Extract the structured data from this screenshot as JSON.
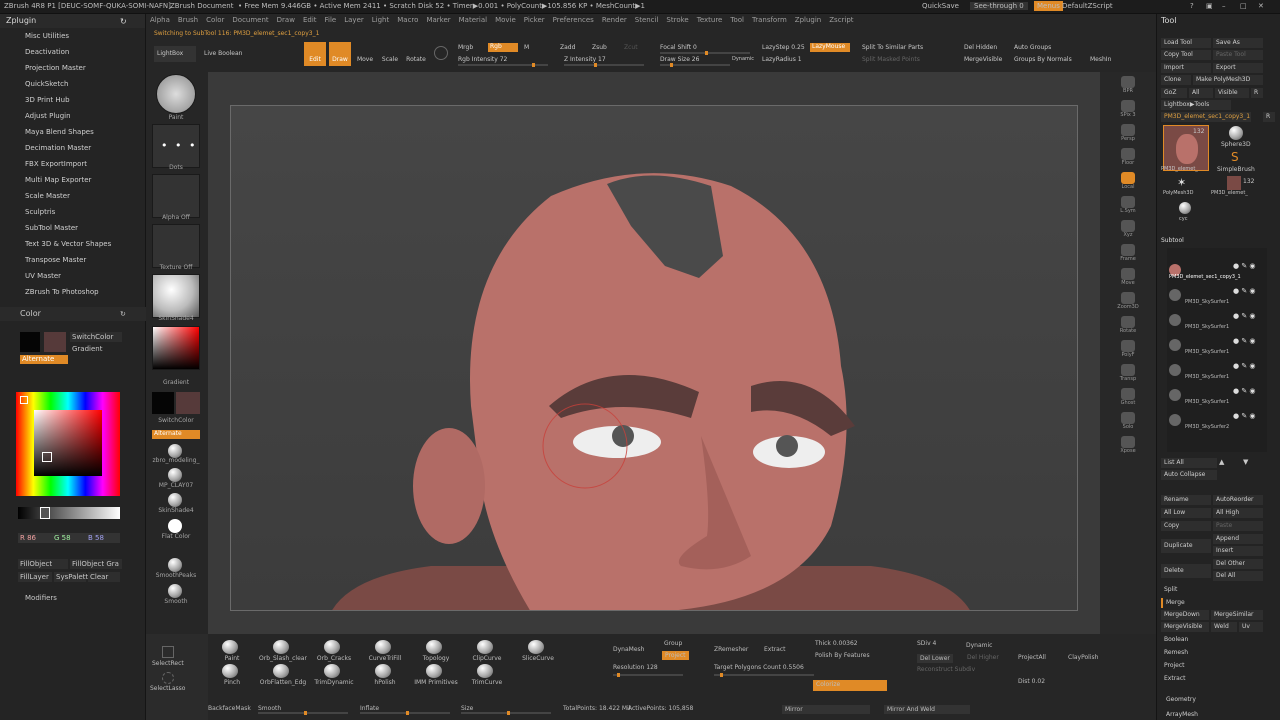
{
  "titlebar": {
    "app": "ZBrush 4R8 P1 [DEUC-SOMF-QUKA-SOMI-NAFN]",
    "doc": "ZBrush Document",
    "stats": "• Free Mem 9.446GB • Active Mem 2411 • Scratch Disk 52 • Timer▶0.001 • PolyCount▶105.856 KP • MeshCount▶1",
    "quicksave": "QuickSave",
    "seethrough": "See-through  0",
    "menus": "Menus",
    "defaultscript": "DefaultZScript"
  },
  "menubar": [
    "Alpha",
    "Brush",
    "Color",
    "Document",
    "Draw",
    "Edit",
    "File",
    "Layer",
    "Light",
    "Macro",
    "Marker",
    "Material",
    "Movie",
    "Picker",
    "Preferences",
    "Render",
    "Stencil",
    "Stroke",
    "Texture",
    "Tool",
    "Transform",
    "Zplugin",
    "Zscript"
  ],
  "zplugin": {
    "title": "Zplugin",
    "items": [
      "Misc Utilities",
      "Deactivation",
      "Projection Master",
      "QuickSketch",
      "3D Print Hub",
      "Adjust Plugin",
      "Maya Blend Shapes",
      "Decimation Master",
      "FBX ExportImport",
      "Multi Map Exporter",
      "Scale Master",
      "Sculptris",
      "SubTool Master",
      "Text 3D & Vector Shapes",
      "Transpose Master",
      "UV Master",
      "ZBrush To Photoshop"
    ]
  },
  "colorpanel": {
    "title": "Color",
    "switchcolor": "SwitchColor",
    "gradient": "Gradient",
    "alternate": "Alternate",
    "r": "R 86",
    "g": "G 58",
    "b": "B 58",
    "fillobject": "FillObject",
    "fillobject_gra": "FillObject Gra",
    "filllayer": "FillLayer",
    "syspalette": "SysPalette",
    "clear": "Clear",
    "modifiers": "Modifiers"
  },
  "shelf": {
    "switching": "Switching to SubTool 116:  PM3D_elemet_sec1_copy3_1",
    "lightbox": "LightBox",
    "liveboolean": "Live Boolean",
    "edit": "Edit",
    "draw": "Draw",
    "move": "Move",
    "scale": "Scale",
    "rotate": "Rotate",
    "mrgb": "Mrgb",
    "rgb": "Rgb",
    "m": "M",
    "rgbintensity": "Rgb Intensity 72",
    "zadd": "Zadd",
    "zsub": "Zsub",
    "zcut": "Zcut",
    "zintensity": "Z Intensity 17",
    "focalshift": "Focal Shift 0",
    "drawsize": "Draw Size 26",
    "dynamic": "Dynamic",
    "lazystep": "LazyStep 0.25",
    "lazymouse": "LazyMouse",
    "lazyradius": "LazyRadius 1",
    "splitsimilar": "Split To Similar Parts",
    "splitmasked": "Split Masked Points",
    "delhidden": "Del Hidden",
    "mergevisible": "MergeVisible",
    "autogroups": "Auto Groups",
    "groupsbynormals": "Groups By Normals",
    "mesh": "MeshIn"
  },
  "brushcol": {
    "paint": "Paint",
    "dots": "Dots",
    "alphaoff": "Alpha Off",
    "textureoff": "Texture Off",
    "skinshade4": "SkinShade4",
    "gradient": "Gradient",
    "switchcolor": "SwitchColor",
    "alternate": "Alternate",
    "mat1": "zbro_modeling_",
    "mat2": "MP_CLAY07",
    "mat3": "SkinShade4",
    "mat4": "Flat Color",
    "smoothpeaks": "SmoothPeaks",
    "smooth": "Smooth"
  },
  "rightstrip": [
    "BPR",
    "SPix 3",
    "Persp",
    "Floor",
    "Local",
    "L.Sym",
    "Xyz",
    "Frame",
    "Move",
    "Zoom3D",
    "Rotate",
    "PolyF",
    "Transp",
    "Ghost",
    "Solo",
    "Xpose"
  ],
  "toolpanel": {
    "title": "Tool",
    "loadtool": "Load Tool",
    "saveas": "Save As",
    "copytool": "Copy Tool",
    "pastetool": "Paste Tool",
    "import": "Import",
    "export": "Export",
    "clone": "Clone",
    "makepolymesh": "Make PolyMesh3D",
    "goz": "GoZ",
    "all": "All",
    "visible": "Visible",
    "r": "R",
    "lightbox": "Lightbox▶Tools",
    "current": "PM3D_elemet_sec1_copy3_1",
    "r2": "R",
    "count132": "132",
    "sphere3d": "Sphere3D",
    "simplebrush": "SimpleBrush",
    "current_thumb": "PM3D_elemet_",
    "polymesh3d": "PolyMesh3D",
    "pm3d2": "PM3D_elemet_",
    "count132b": "132",
    "cyc": "cyc",
    "subtool": "Subtool",
    "subtools": [
      "PM3D_elemet_sec1_copy3_1",
      "PM3D_SkySurfer1",
      "PM3D_SkySurfer1",
      "PM3D_SkySurfer1",
      "PM3D_SkySurfer1",
      "PM3D_SkySurfer1",
      "PM3D_SkySurfer2"
    ],
    "listall": "List All",
    "autocollapse": "Auto Collapse",
    "rename": "Rename",
    "autoreorder": "AutoReorder",
    "alllow": "All Low",
    "allhigh": "All High",
    "copy": "Copy",
    "paste": "Paste",
    "duplicate": "Duplicate",
    "append": "Append",
    "insert": "Insert",
    "delete": "Delete",
    "delother": "Del Other",
    "delall": "Del All",
    "split": "Split",
    "merge": "Merge",
    "mergedown": "MergeDown",
    "mergesimilar": "MergeSimilar",
    "mergevisible": "MergeVisible",
    "weld": "Weld",
    "uv": "Uv",
    "boolean": "Boolean",
    "remesh": "Remesh",
    "project": "Project",
    "extract": "Extract",
    "geometry": "Geometry",
    "arraymesh": "ArrayMesh"
  },
  "bottombar": {
    "brushes": [
      "Paint",
      "Orb_Slash_clear",
      "Orb_Cracks",
      "CurveTriFill",
      "Topology",
      "ClipCurve",
      "SliceCurve"
    ],
    "brushes2": [
      "Pinch",
      "OrbFlatten_Edg",
      "TrimDynamic",
      "hPolish",
      "IMM Primitives",
      "TrimCurve"
    ],
    "selectrect": "SelectRect",
    "selectlasso": "SelectLasso",
    "dynamesh": "DynaMesh",
    "group": "Group",
    "project": "Project",
    "resolution": "Resolution 128",
    "zremesher": "ZRemesher",
    "targetpoly": "Target Polygons Count 0.5506",
    "extract": "Extract",
    "thick": "Thick 0.00362",
    "polishbyfeatures": "Polish By Features",
    "colorize": "Colorize",
    "sdiv": "SDiv 4",
    "dynamic": "Dynamic",
    "dellower": "Del Lower",
    "delhigher": "Del Higher",
    "reconstruct": "Reconstruct Subdiv",
    "projectall": "ProjectAll",
    "dist": "Dist 0.02",
    "claypolish": "ClayPolish",
    "backfacemask": "BackfaceMask",
    "smooth": "Smooth",
    "inflate": "Inflate",
    "size": "Size",
    "totalpoints": "TotalPoints: 18.422 Mil",
    "activepoints": "ActivePoints: 105,858",
    "mirror": "Mirror",
    "mirrorweld": "Mirror And Weld"
  },
  "colors": {
    "accent": "#e08a26",
    "bg": "#2b2b2b",
    "skin": "#b9716a",
    "helmet": "#4a4a4a"
  }
}
